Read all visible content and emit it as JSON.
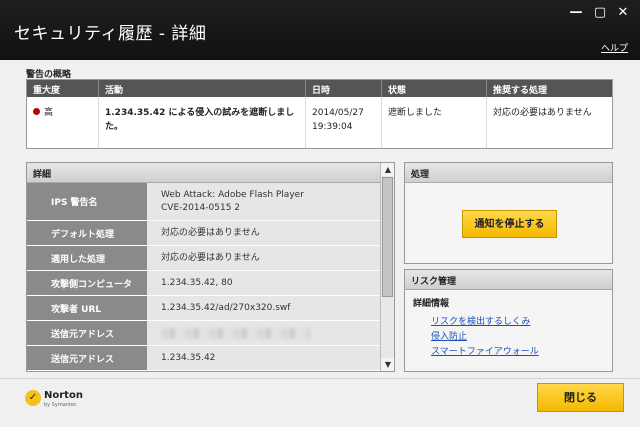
{
  "window": {
    "title": "セキュリティ履歴 - 詳細",
    "help": "ヘルプ",
    "minimize_glyph": "—",
    "restore_glyph": "▢",
    "close_glyph": "✕"
  },
  "summary": {
    "label": "警告の概略",
    "headers": [
      "重大度",
      "活動",
      "日時",
      "状態",
      "推奨する処理"
    ],
    "row": {
      "severity": "高",
      "severity_color": "#c00000",
      "activity": "1.234.35.42 による侵入の試みを遮断しました。",
      "date": "2014/05/27",
      "time": "19:39:04",
      "status": "遮断しました",
      "recommended": "対応の必要はありません"
    }
  },
  "details": {
    "title": "詳細",
    "rows": [
      {
        "label": "IPS 警告名",
        "value": "Web Attack: Adobe Flash Player\nCVE-2014-0515 2"
      },
      {
        "label": "デフォルト処理",
        "value": "対応の必要はありません"
      },
      {
        "label": "適用した処理",
        "value": "対応の必要はありません"
      },
      {
        "label": "攻撃側コンピュータ",
        "value": "1.234.35.42, 80"
      },
      {
        "label": "攻撃者 URL",
        "value": "1.234.35.42/ad/270x320.swf"
      },
      {
        "label": "送信元アドレス",
        "value": ""
      },
      {
        "label": "送信元アドレス",
        "value": "1.234.35.42"
      }
    ]
  },
  "action_panel": {
    "title": "処理",
    "stop_button": "通知を停止する"
  },
  "risk_panel": {
    "title": "リスク管理",
    "subtitle": "詳細情報",
    "links": [
      "リスクを検出するしくみ",
      "侵入防止",
      "スマートファイアウォール"
    ]
  },
  "footer": {
    "brand": "Norton",
    "brand_sub": "by Symantec",
    "close_button": "閉じる"
  },
  "colors": {
    "accent": "#f5b800",
    "titlebar": "#1a1a1a",
    "link": "#1a4fb5"
  }
}
